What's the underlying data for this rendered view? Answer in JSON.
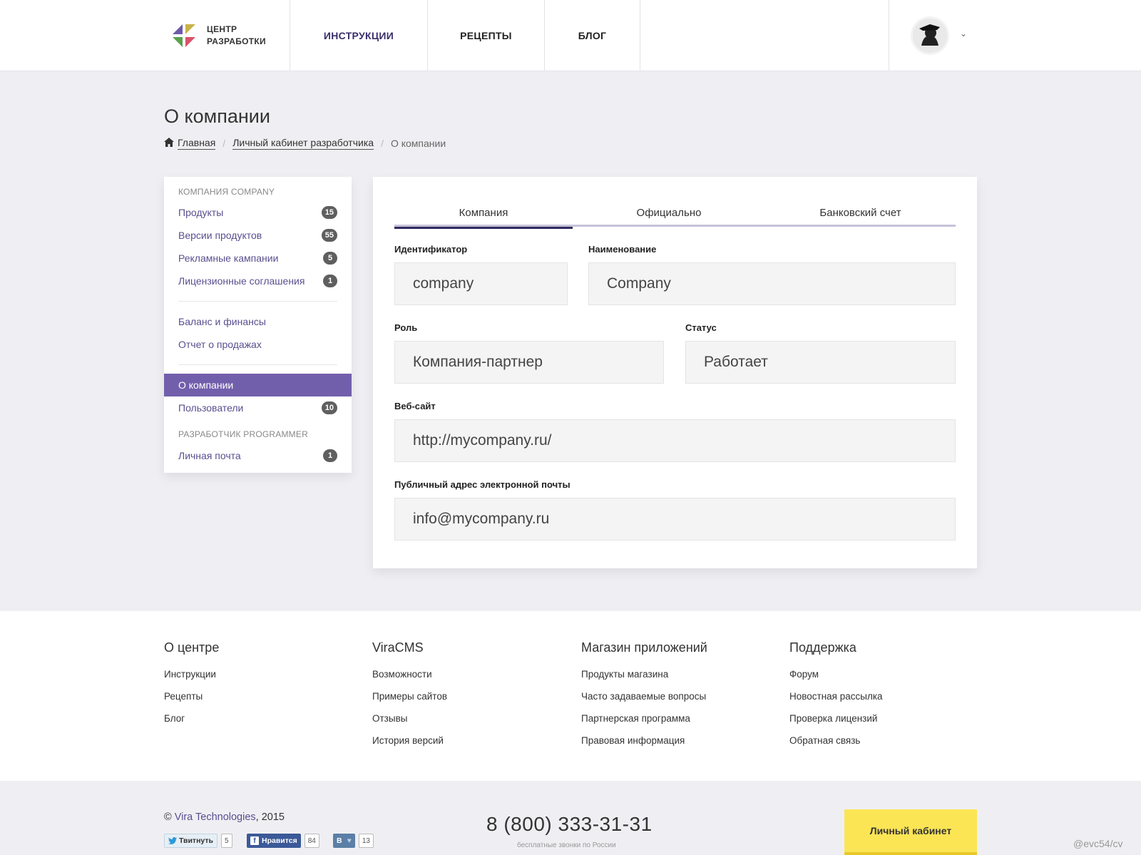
{
  "header": {
    "logo_text_1": "ЦЕНТР",
    "logo_text_2": "РАЗРАБОТКИ",
    "nav": [
      "ИНСТРУКЦИИ",
      "РЕЦЕПТЫ",
      "БЛОГ"
    ],
    "active_nav": "ИНСТРУКЦИИ",
    "chevron": "⌄"
  },
  "page": {
    "title": "О компании",
    "breadcrumb": [
      "Главная",
      "Личный кабинет разработчика",
      "О компании"
    ],
    "breadcrumb_sep": "/"
  },
  "sidebar": {
    "group1": "КОМПАНИЯ COMPANY",
    "items1": [
      {
        "label": "Продукты",
        "badge": "15"
      },
      {
        "label": "Версии продуктов",
        "badge": "55"
      },
      {
        "label": "Рекламные кампании",
        "badge": "5"
      },
      {
        "label": "Лицензионные соглашения",
        "badge": "1"
      }
    ],
    "items2": [
      {
        "label": "Баланс и финансы"
      },
      {
        "label": "Отчет о продажах"
      }
    ],
    "items3": [
      {
        "label": "О компании",
        "active": true
      },
      {
        "label": "Пользователи",
        "badge": "10"
      }
    ],
    "group2": "РАЗРАБОТЧИК PROGRAMMER",
    "items4": [
      {
        "label": "Личная почта",
        "badge": "1"
      }
    ]
  },
  "tabs": [
    "Компания",
    "Официально",
    "Банковский счет"
  ],
  "form": {
    "id_label": "Идентификатор",
    "id_value": "company",
    "name_label": "Наименование",
    "name_value": "Company",
    "role_label": "Роль",
    "role_value": "Компания-партнер",
    "status_label": "Статус",
    "status_value": "Работает",
    "site_label": "Веб-сайт",
    "site_value": "http://mycompany.ru/",
    "email_label": "Публичный адрес электронной почты",
    "email_value": "info@mycompany.ru"
  },
  "footer": {
    "cols": [
      {
        "title": "О центре",
        "links": [
          "Инструкции",
          "Рецепты",
          "Блог"
        ]
      },
      {
        "title": "ViraCMS",
        "links": [
          "Возможности",
          "Примеры сайтов",
          "Отзывы",
          "История версий"
        ]
      },
      {
        "title": "Магазин приложений",
        "links": [
          "Продукты магазина",
          "Часто задаваемые вопросы",
          "Партнерская программа",
          "Правовая информация"
        ]
      },
      {
        "title": "Поддержка",
        "links": [
          "Форум",
          "Новостная рассылка",
          "Проверка лицензий",
          "Обратная связь"
        ]
      }
    ],
    "copyright_symbol": "©",
    "brand": "Vira Technologies",
    "year": ", 2015",
    "social": {
      "twitter_label": "Твитнуть",
      "twitter_count": "5",
      "facebook_label": "Нравится",
      "facebook_count": "84",
      "vk_label": "В",
      "vk_count": "13"
    },
    "phone": "8 (800) 333-31-31",
    "phone_note": "бесплатные звонки по России",
    "cabinet_button": "Личный кабинет",
    "watermark": "@evc54/cv"
  },
  "colors": {
    "accent": "#725fac",
    "nav_active": "#3a2f6b",
    "button_yellow": "#fbe555"
  }
}
